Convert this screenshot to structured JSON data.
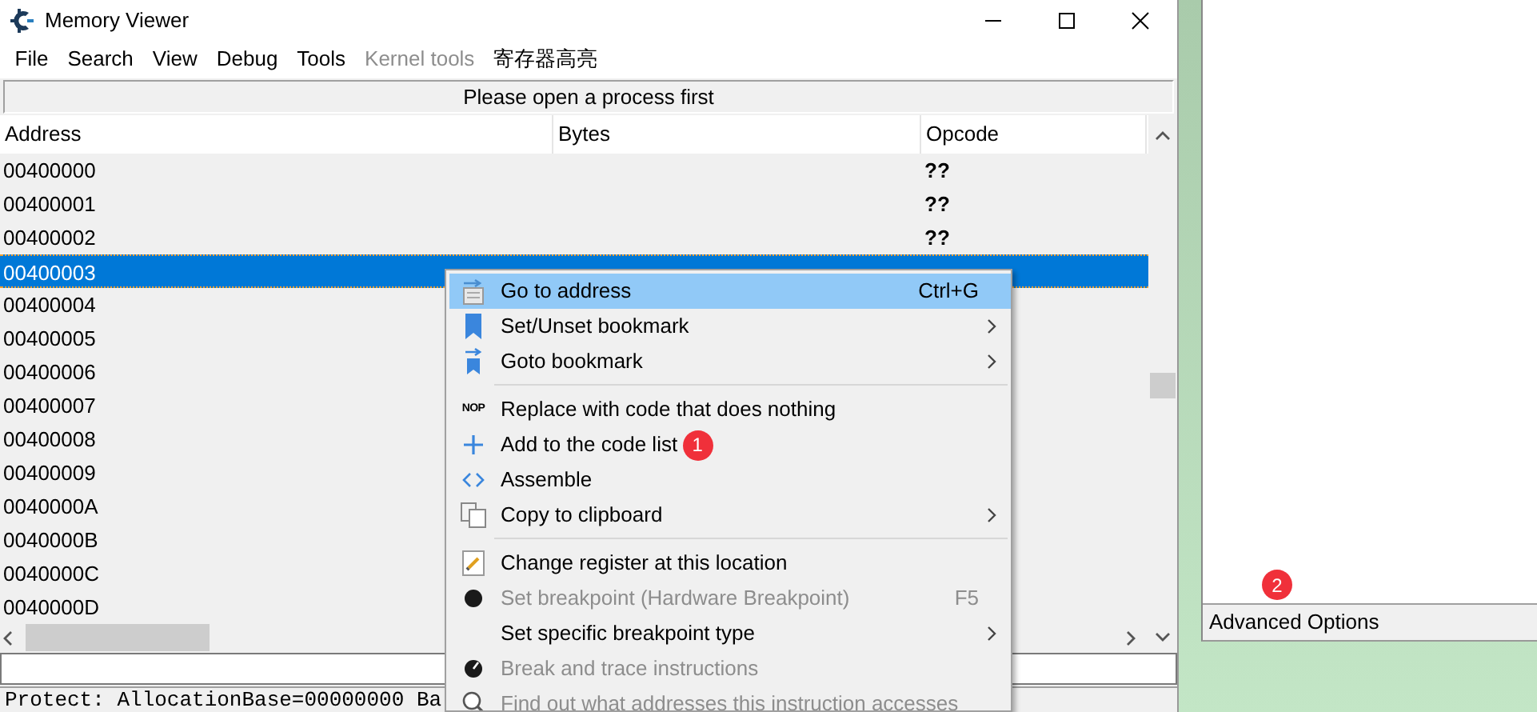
{
  "window": {
    "title": "Memory Viewer"
  },
  "menu_bar": [
    {
      "label": "File",
      "disabled": false
    },
    {
      "label": "Search",
      "disabled": false
    },
    {
      "label": "View",
      "disabled": false
    },
    {
      "label": "Debug",
      "disabled": false
    },
    {
      "label": "Tools",
      "disabled": false
    },
    {
      "label": "Kernel tools",
      "disabled": true
    },
    {
      "label": "寄存器高亮",
      "disabled": false
    }
  ],
  "banner": "Please open a process first",
  "table": {
    "columns": [
      "Address",
      "Bytes",
      "Opcode"
    ],
    "rows": [
      {
        "address": "00400000",
        "opcode": "??",
        "selected": false
      },
      {
        "address": "00400001",
        "opcode": "??",
        "selected": false
      },
      {
        "address": "00400002",
        "opcode": "??",
        "selected": false
      },
      {
        "address": "00400003",
        "selected": true
      },
      {
        "address": "00400004",
        "selected": false
      },
      {
        "address": "00400005",
        "selected": false
      },
      {
        "address": "00400006",
        "selected": false
      },
      {
        "address": "00400007",
        "selected": false
      },
      {
        "address": "00400008",
        "selected": false
      },
      {
        "address": "00400009",
        "selected": false
      },
      {
        "address": "0040000A",
        "selected": false
      },
      {
        "address": "0040000B",
        "selected": false
      },
      {
        "address": "0040000C",
        "selected": false
      },
      {
        "address": "0040000D",
        "selected": false
      }
    ]
  },
  "status_text": "Protect: AllocationBase=00000000 Ba",
  "context_menu": [
    {
      "kind": "item",
      "label": "Go to address",
      "shortcut": "Ctrl+G",
      "selected": true,
      "disabled": false,
      "submenu": false
    },
    {
      "kind": "item",
      "label": "Set/Unset bookmark",
      "selected": false,
      "disabled": false,
      "submenu": true
    },
    {
      "kind": "item",
      "label": "Goto bookmark",
      "selected": false,
      "disabled": false,
      "submenu": true
    },
    {
      "kind": "separator"
    },
    {
      "kind": "item",
      "label": "Replace with code that does nothing",
      "icon_label": "NOP",
      "selected": false,
      "disabled": false,
      "submenu": false
    },
    {
      "kind": "item",
      "label": "Add to the code list",
      "badge": "1",
      "selected": false,
      "disabled": false,
      "submenu": false
    },
    {
      "kind": "item",
      "label": "Assemble",
      "selected": false,
      "disabled": false,
      "submenu": false
    },
    {
      "kind": "item",
      "label": "Copy to clipboard",
      "selected": false,
      "disabled": false,
      "submenu": true
    },
    {
      "kind": "separator"
    },
    {
      "kind": "item",
      "label": "Change register at this location",
      "selected": false,
      "disabled": false,
      "submenu": false
    },
    {
      "kind": "item",
      "label": "Set breakpoint (Hardware Breakpoint)",
      "shortcut": "F5",
      "selected": false,
      "disabled": true,
      "submenu": false
    },
    {
      "kind": "item",
      "label": "Set specific breakpoint type",
      "selected": false,
      "disabled": false,
      "submenu": true
    },
    {
      "kind": "item",
      "label": "Break and trace instructions",
      "selected": false,
      "disabled": true,
      "submenu": false
    },
    {
      "kind": "item",
      "label": "Find out what addresses this instruction accesses",
      "selected": false,
      "disabled": true,
      "submenu": false
    }
  ],
  "side_panel": {
    "badge": "2",
    "footer": "Advanced Options"
  }
}
